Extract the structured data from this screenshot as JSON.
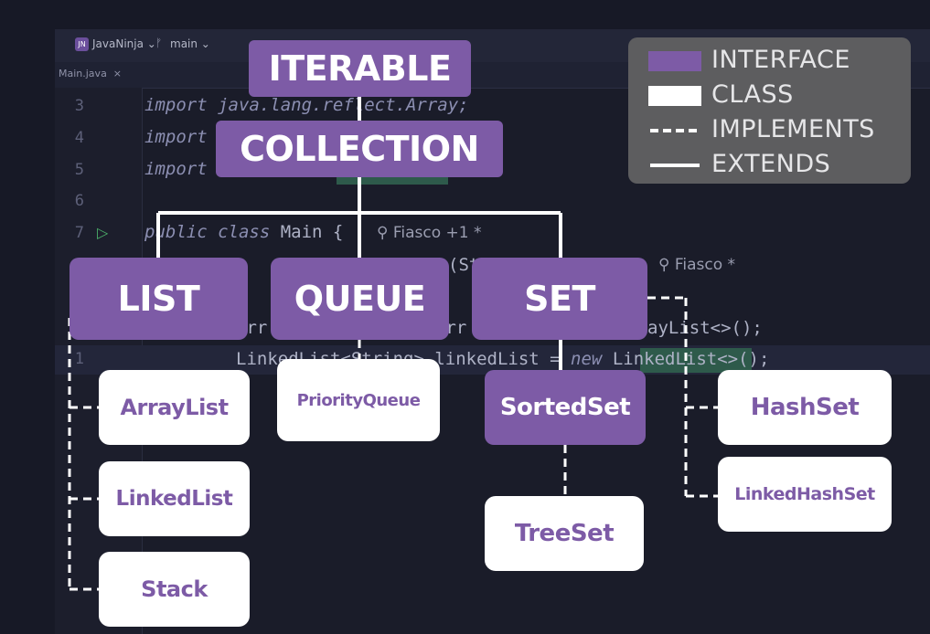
{
  "ide": {
    "project_badge": "JN",
    "project_name": "JavaNinja",
    "branch_icon": "git-branch-icon",
    "branch_name": "main",
    "file_tab": "Main.java",
    "line_numbers": [
      "3",
      "4",
      "5",
      "6",
      "7",
      "1"
    ],
    "code_lines": {
      "line3": "import java.lang.reflect.Array;",
      "line4": "import",
      "line5": "import",
      "line7_kw": "public class",
      "line7_name": " Main {",
      "line_str_fragment": "(St",
      "line_arr1": "Arr",
      "line_arr2": "Arr",
      "line_arraylist_tail": "ayList<>();",
      "line_linked_a": "LinkedList<String> linkedList = ",
      "line_linked_new": "new",
      "line_linked_b": " LinkedList<>();"
    },
    "hints": {
      "author1": "Fiasco +1 *",
      "author2": "Fiasco *"
    }
  },
  "diagram": {
    "interfaces": {
      "iterable": "ITERABLE",
      "collection": "COLLECTION",
      "list": "LIST",
      "queue": "QUEUE",
      "set": "SET",
      "sortedset": "SortedSet"
    },
    "classes": {
      "arraylist": "ArrayList",
      "linkedlist": "LinkedList",
      "stack": "Stack",
      "priorityqueue": "PriorityQueue",
      "treeset": "TreeSet",
      "hashset": "HashSet",
      "linkedhashset": "LinkedHashSet"
    }
  },
  "legend": {
    "interface": "INTERFACE",
    "class": "CLASS",
    "implements": "IMPLEMENTS",
    "extends": "EXTENDS"
  },
  "colors": {
    "interface_fill": "#7d5ba6",
    "class_fill": "#ffffff",
    "connector": "#ffffff",
    "legend_bg": "#5d5d5f",
    "ide_bg": "#1a1c29"
  }
}
